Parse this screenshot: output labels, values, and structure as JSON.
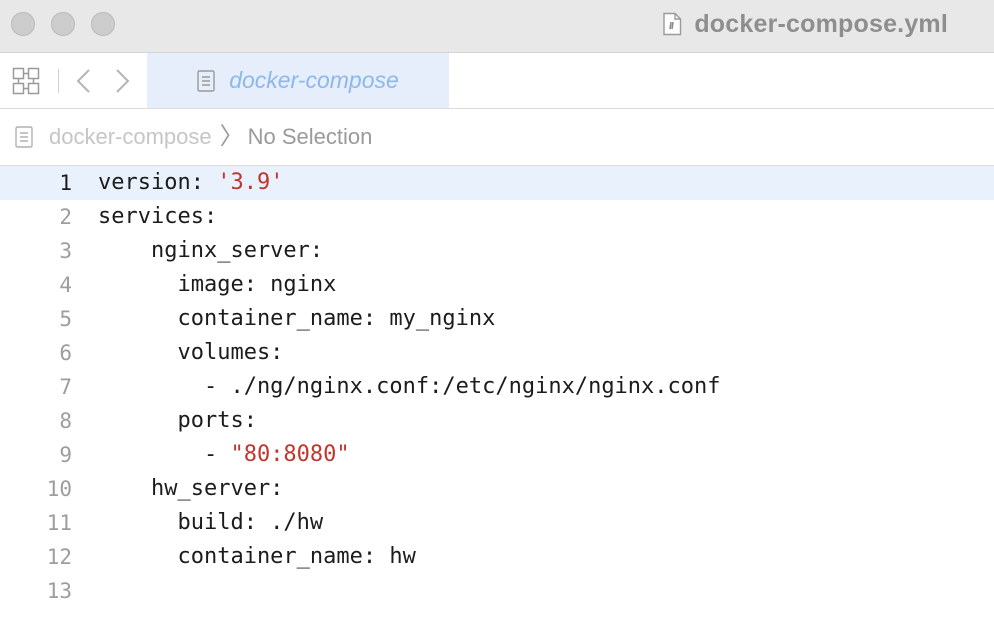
{
  "window": {
    "title": "docker-compose.yml"
  },
  "tab": {
    "label": "docker-compose"
  },
  "breadcrumb": {
    "file": "docker-compose",
    "separator": "〉",
    "selection": "No Selection"
  },
  "editor": {
    "current_line": 1,
    "lines": [
      {
        "num": "1",
        "code": "version: ",
        "str": "'3.9'"
      },
      {
        "num": "2",
        "code": "services:",
        "str": ""
      },
      {
        "num": "3",
        "code": "    nginx_server:",
        "str": ""
      },
      {
        "num": "4",
        "code": "      image: nginx",
        "str": ""
      },
      {
        "num": "5",
        "code": "      container_name: my_nginx",
        "str": ""
      },
      {
        "num": "6",
        "code": "      volumes:",
        "str": ""
      },
      {
        "num": "7",
        "code": "        - ./ng/nginx.conf:/etc/nginx/nginx.conf",
        "str": ""
      },
      {
        "num": "8",
        "code": "      ports:",
        "str": ""
      },
      {
        "num": "9",
        "code": "        - ",
        "str": "\"80:8080\""
      },
      {
        "num": "10",
        "code": "    hw_server:",
        "str": ""
      },
      {
        "num": "11",
        "code": "      build: ./hw",
        "str": ""
      },
      {
        "num": "12",
        "code": "      container_name: hw",
        "str": ""
      },
      {
        "num": "13",
        "code": "",
        "str": ""
      }
    ]
  },
  "colors": {
    "string": "#c2352c",
    "current_line_bg": "#e9f1fc",
    "tab_bg": "#e5eefa",
    "tab_text": "#8db8ea"
  },
  "icons": {
    "grid": "grid-view-icon",
    "back": "chevron-left-icon",
    "forward": "chevron-right-icon",
    "document": "document-icon"
  }
}
